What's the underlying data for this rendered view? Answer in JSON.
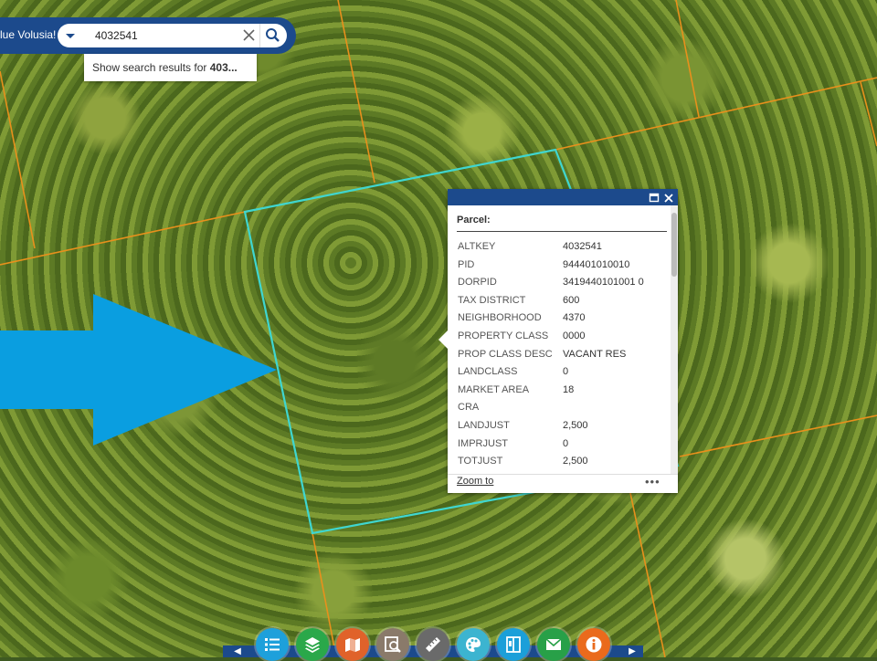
{
  "search": {
    "app_label": "lue Volusia!",
    "value": "4032541",
    "suggestion_prefix": "Show search results for ",
    "suggestion_term": "403..."
  },
  "popup": {
    "title": "Parcel:",
    "fields": [
      {
        "label": "ALTKEY",
        "value": "4032541"
      },
      {
        "label": "PID",
        "value": "944401010010"
      },
      {
        "label": "DORPID",
        "value": "3419440101001 0"
      },
      {
        "label": "TAX DISTRICT",
        "value": "600"
      },
      {
        "label": "NEIGHBORHOOD",
        "value": "4370"
      },
      {
        "label": "PROPERTY CLASS",
        "value": "0000"
      },
      {
        "label": "PROP CLASS DESC",
        "value": "VACANT RES"
      },
      {
        "label": "LANDCLASS",
        "value": "0"
      },
      {
        "label": "MARKET AREA",
        "value": "18"
      },
      {
        "label": "CRA",
        "value": ""
      },
      {
        "label": "LANDJUST",
        "value": "2,500"
      },
      {
        "label": "IMPRJUST",
        "value": "0"
      },
      {
        "label": "TOTJUST",
        "value": "2,500"
      }
    ],
    "zoom_label": "Zoom to",
    "more_label": "•••"
  },
  "toolbar": {
    "tools": [
      {
        "name": "legend-tool",
        "icon": "list-icon",
        "color": "#1ea0db"
      },
      {
        "name": "layers-tool",
        "icon": "layers-icon",
        "color": "#2aa84a"
      },
      {
        "name": "basemap-tool",
        "icon": "basemap-icon",
        "color": "#e0622a"
      },
      {
        "name": "identify-tool",
        "icon": "identify-icon",
        "color": "#8a7a6a"
      },
      {
        "name": "measure-tool",
        "icon": "ruler-icon",
        "color": "#6a6a6a"
      },
      {
        "name": "draw-tool",
        "icon": "palette-icon",
        "color": "#3cb4d0"
      },
      {
        "name": "print-tool",
        "icon": "print-icon",
        "color": "#1b9fd9"
      },
      {
        "name": "share-tool",
        "icon": "mail-icon",
        "color": "#28a048"
      },
      {
        "name": "about-tool",
        "icon": "info-icon",
        "color": "#ea6a1c"
      }
    ]
  },
  "colors": {
    "header_blue": "#1c4a8c",
    "parcel_line": "#e8901c",
    "selection": "#3fd6d0",
    "arrow": "#0a9ee0"
  }
}
